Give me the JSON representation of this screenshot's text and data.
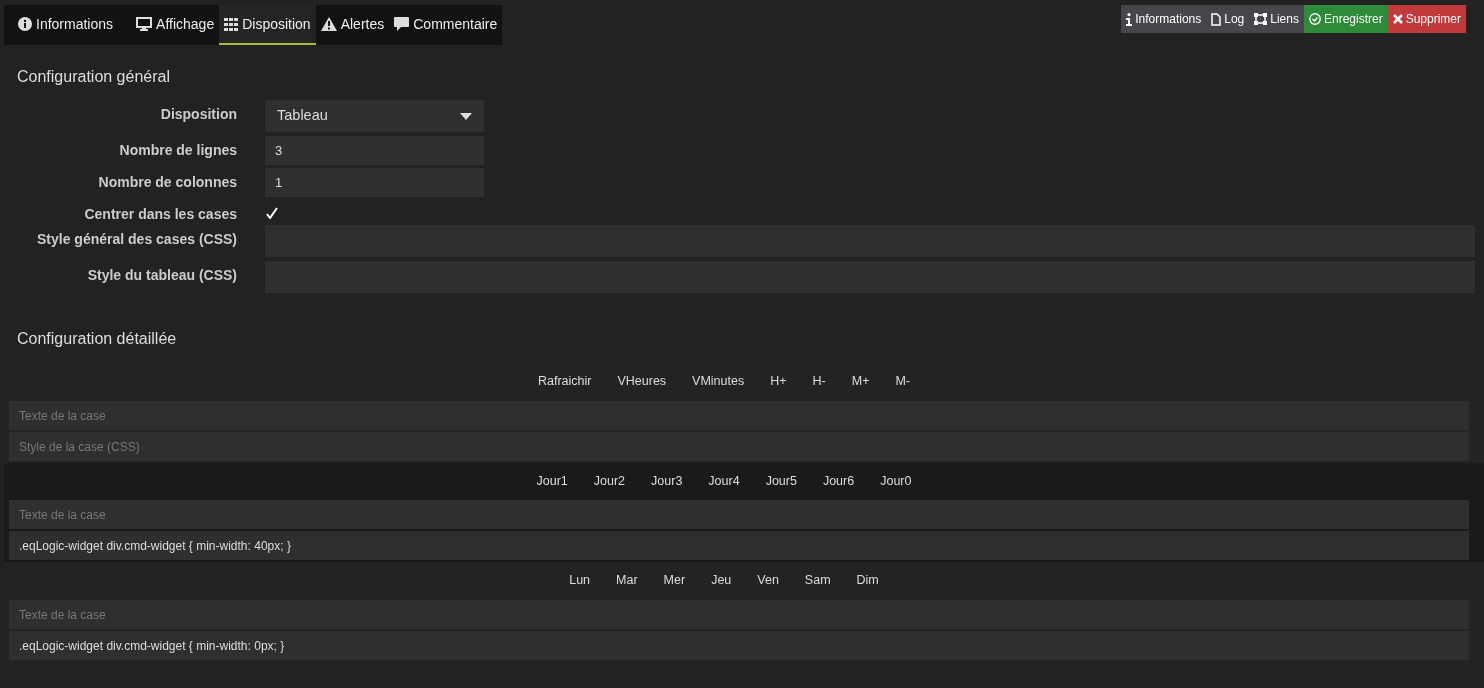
{
  "tabs": [
    {
      "label": "Informations",
      "selected": false
    },
    {
      "label": "Affichage",
      "selected": false
    },
    {
      "label": "Disposition",
      "selected": true
    },
    {
      "label": "Alertes",
      "selected": false
    },
    {
      "label": "Commentaire",
      "selected": false
    }
  ],
  "actions": [
    {
      "label": "Informations",
      "kind": "default"
    },
    {
      "label": "Log",
      "kind": "default"
    },
    {
      "label": "Liens",
      "kind": "default"
    },
    {
      "label": "Enregistrer",
      "kind": "success"
    },
    {
      "label": "Supprimer",
      "kind": "danger"
    }
  ],
  "general": {
    "title": "Configuration général",
    "fields": [
      {
        "label": "Disposition",
        "kind": "select",
        "value": "Tableau"
      },
      {
        "label": "Nombre de lignes",
        "kind": "number",
        "value": "3"
      },
      {
        "label": "Nombre de colonnes",
        "kind": "number",
        "value": "1"
      },
      {
        "label": "Centrer dans les cases",
        "kind": "checkbox",
        "checked": true
      },
      {
        "label": "Style général des cases (CSS)",
        "kind": "textarea"
      },
      {
        "label": "Style du tableau (CSS)",
        "kind": "textarea"
      }
    ]
  },
  "detailed": {
    "title": "Configuration détaillée",
    "cells": [
      {
        "highlighted": false,
        "commands": [
          "Rafraichir",
          "VHeures",
          "VMinutes",
          "H+",
          "H-",
          "M+",
          "M-"
        ],
        "text_placeholder": "Texte de la case",
        "style_placeholder": "Style de la case (CSS)"
      },
      {
        "highlighted": true,
        "commands": [
          "Jour1",
          "Jour2",
          "Jour3",
          "Jour4",
          "Jour5",
          "Jour6",
          "Jour0"
        ],
        "text_placeholder": "Texte de la case",
        "style_value": ".eqLogic-widget div.cmd-widget { min-width: 40px; }"
      },
      {
        "highlighted": false,
        "commands": [
          "Lun",
          "Mar",
          "Mer",
          "Jeu",
          "Ven",
          "Sam",
          "Dim"
        ],
        "text_placeholder": "Texte de la case",
        "style_value": ".eqLogic-widget div.cmd-widget { min-width: 0px; }"
      }
    ]
  }
}
